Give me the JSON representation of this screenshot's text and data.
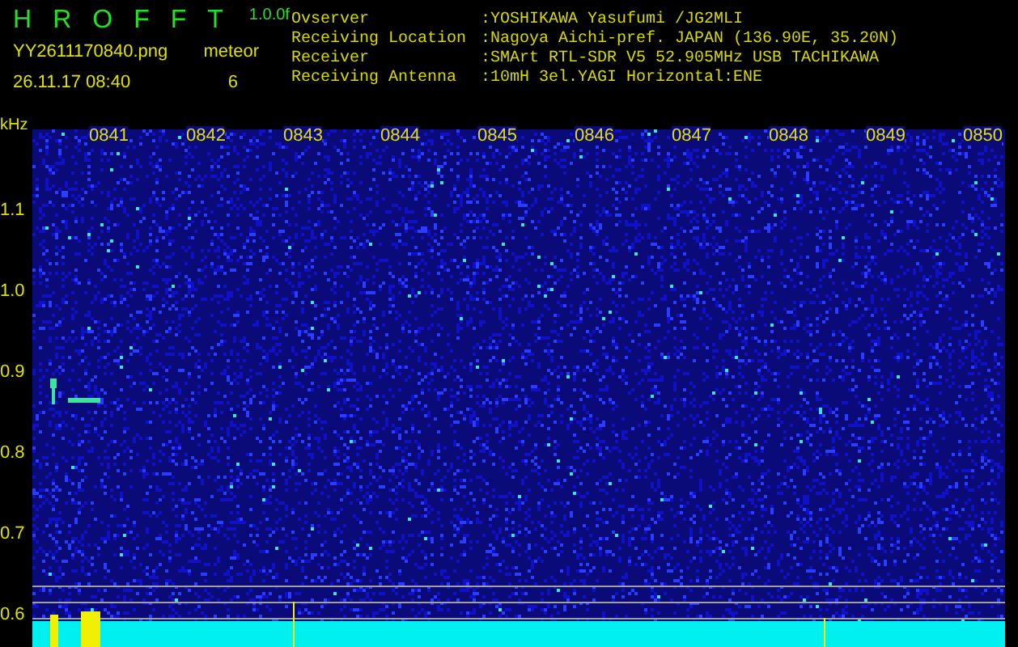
{
  "app": {
    "title_letters": [
      "H",
      "R",
      "O",
      "F",
      "F",
      "T"
    ],
    "version": "1.0.0f"
  },
  "capture": {
    "file": "YY2611170840.png",
    "datetime": "26.11.17 08:40",
    "count_label": "meteor",
    "count": "6"
  },
  "station_info": [
    {
      "label": "Ovserver",
      "value": ":YOSHIKAWA Yasufumi /JG2MLI"
    },
    {
      "label": "Receiving Location",
      "value": ":Nagoya Aichi-pref. JAPAN (136.90E, 35.20N)"
    },
    {
      "label": "Receiver",
      "value": ":SMArt RTL-SDR V5 52.905MHz USB TACHIKAWA"
    },
    {
      "label": "Receiving Antenna",
      "value": ":10mH 3el.YAGI Horizontal:ENE"
    }
  ],
  "spectrogram": {
    "y_unit": "kHz",
    "y_ticks": [
      "1.1",
      "1.0",
      "0.9",
      "0.8",
      "0.7",
      "0.6"
    ],
    "time_labels": [
      "0841",
      "0842",
      "0843",
      "0844",
      "0845",
      "0846",
      "0847",
      "0848",
      "0849",
      "0850"
    ]
  }
}
